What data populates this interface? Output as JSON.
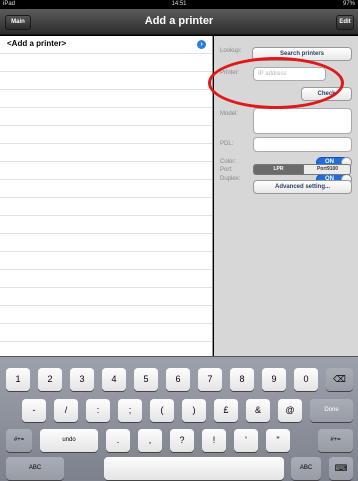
{
  "status_bar": {
    "device": "iPad",
    "time": "14:51",
    "battery": "97%"
  },
  "nav": {
    "title": "Add a printer",
    "left_button": "Main",
    "right_button": "Edit"
  },
  "list": {
    "rows": [
      "<Add a printer>"
    ]
  },
  "panel": {
    "lookup_label": "Lookup:",
    "search_button": "Search printers",
    "printer_label": "Printer:",
    "printer_placeholder": "IP address",
    "check_button": "Check",
    "model_label": "Model:",
    "pdl_label": "PDL:",
    "color_label": "Color:",
    "color_state": "ON",
    "duplex_label": "Duplex:",
    "duplex_state": "ON",
    "port_label": "Port:",
    "port_options": [
      "LPR",
      "Port9100"
    ],
    "advanced_button": "Advanced setting..."
  },
  "keyboard": {
    "row1": [
      "1",
      "2",
      "3",
      "4",
      "5",
      "6",
      "7",
      "8",
      "9",
      "0"
    ],
    "row2": [
      "-",
      "/",
      ":",
      ";",
      "(",
      ")",
      "£",
      "&",
      "@"
    ],
    "row2_done": "Done",
    "row3_left": "#+=",
    "row3_undo": "undo",
    "row3": [
      ".",
      ",",
      "?",
      "!",
      "'",
      "\""
    ],
    "row3_right": "#+=",
    "row4_left": "ABC",
    "row4_right": "ABC"
  },
  "colors": {
    "accent": "#1f6ee0",
    "annotation": "#e01818"
  }
}
